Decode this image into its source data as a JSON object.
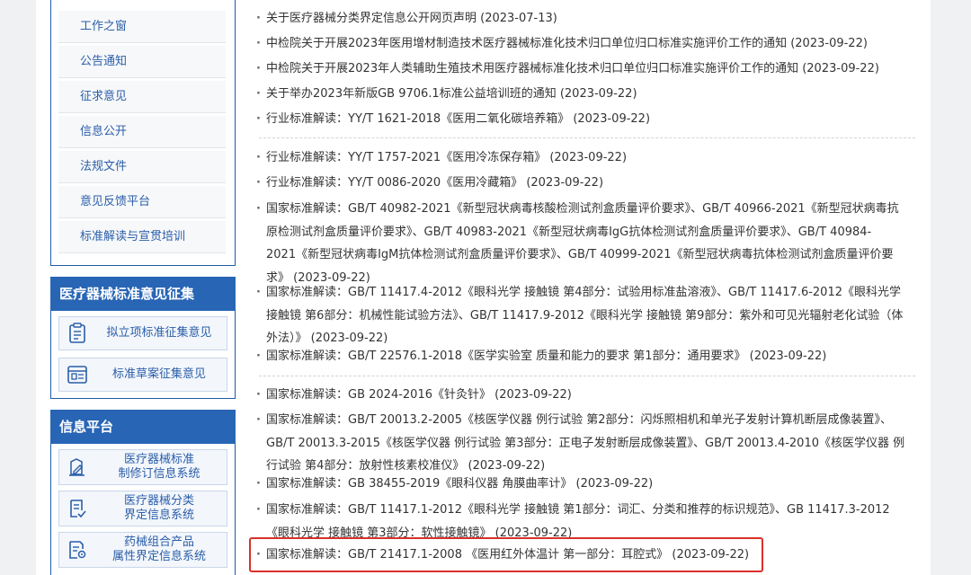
{
  "sidebar": {
    "nav": [
      {
        "label": "工作之窗"
      },
      {
        "label": "公告通知"
      },
      {
        "label": "征求意见"
      },
      {
        "label": "信息公开"
      },
      {
        "label": "法规文件"
      },
      {
        "label": "意见反馈平台"
      },
      {
        "label": "标准解读与宣贯培训"
      }
    ],
    "panel_standard": {
      "title": "医疗器械标准意见征集",
      "buttons": [
        {
          "label": "拟立项标准征集意见",
          "icon": "clipboard-list-icon"
        },
        {
          "label": "标准草案征集意见",
          "icon": "document-form-icon"
        }
      ]
    },
    "panel_info": {
      "title": "信息平台",
      "buttons": [
        {
          "line1": "医疗器械标准",
          "line2": "制修订信息系统",
          "icon": "edit-document-icon"
        },
        {
          "line1": "医疗器械分类",
          "line2": "界定信息系统",
          "icon": "checklist-icon"
        },
        {
          "line1": "药械组合产品",
          "line2": "属性界定信息系统",
          "icon": "document-settings-icon"
        }
      ]
    }
  },
  "news": [
    {
      "text": "关于医疗器械分类界定信息公开网页声明 (2023-07-13)"
    },
    {
      "text": "中检院关于开展2023年医用增材制造技术医疗器械标准化技术归口单位归口标准实施评价工作的通知 (2023-09-22)"
    },
    {
      "text": "中检院关于开展2023年人类辅助生殖技术用医疗器械标准化技术归口单位归口标准实施评价工作的通知 (2023-09-22)"
    },
    {
      "text": "关于举办2023年新版GB 9706.1标准公益培训班的通知 (2023-09-22)"
    },
    {
      "text": "行业标准解读：YY/T 1621-2018《医用二氧化碳培养箱》 (2023-09-22)"
    },
    {
      "text": "行业标准解读：YY/T 1757-2021《医用冷冻保存箱》 (2023-09-22)"
    },
    {
      "text": "行业标准解读：YY/T 0086-2020《医用冷藏箱》 (2023-09-22)"
    },
    {
      "lines": [
        "国家标准解读：GB/T 40982-2021《新型冠状病毒核酸检测试剂盒质量评价要求》、GB/T 40966-2021《新型冠状病毒抗",
        "原检测试剂盒质量评价要求》、GB/T 40983-2021《新型冠状病毒IgG抗体检测试剂盒质量评价要求》、GB/T 40984-",
        "2021《新型冠状病毒IgM抗体检测试剂盒质量评价要求》、GB/T 40999-2021《新型冠状病毒抗体检测试剂盒质量评价要",
        "求》 (2023-09-22)"
      ]
    },
    {
      "lines": [
        "国家标准解读：GB/T 11417.4-2012《眼科光学 接触镜 第4部分：试验用标准盐溶液》、GB/T 11417.6-2012《眼科光学",
        "接触镜 第6部分：机械性能试验方法》、GB/T 11417.9-2012《眼科光学 接触镜 第9部分：紫外和可见光辐射老化试验（体",
        "外法）》 (2023-09-22)"
      ]
    },
    {
      "text": "国家标准解读：GB/T 22576.1-2018《医学实验室 质量和能力的要求 第1部分：通用要求》 (2023-09-22)"
    },
    {
      "text": "国家标准解读：GB 2024-2016《针灸针》 (2023-09-22)"
    },
    {
      "lines": [
        "国家标准解读：GB/T 20013.2-2005《核医学仪器 例行试验 第2部分：闪烁照相机和单光子发射计算机断层成像装置》、",
        "GB/T 20013.3-2015《核医学仪器 例行试验 第3部分：正电子发射断层成像装置》、GB/T 20013.4-2010《核医学仪器 例",
        "行试验 第4部分：放射性核素校准仪》 (2023-09-22)"
      ]
    },
    {
      "text": "国家标准解读：GB 38455-2019《眼科仪器 角膜曲率计》 (2023-09-22)"
    },
    {
      "lines": [
        "国家标准解读：GB/T 11417.1-2012《眼科光学 接触镜 第1部分：词汇、分类和推荐的标识规范》、GB 11417.3-2012",
        "《眼科光学 接触镜 第3部分：软性接触镜》 (2023-09-22)"
      ]
    },
    {
      "text": "国家标准解读：GB/T 21417.1-2008 《医用红外体温计 第一部分：耳腔式》 (2023-09-22)"
    }
  ],
  "highlight_color": "#d9302b",
  "accent": "#2865b5"
}
